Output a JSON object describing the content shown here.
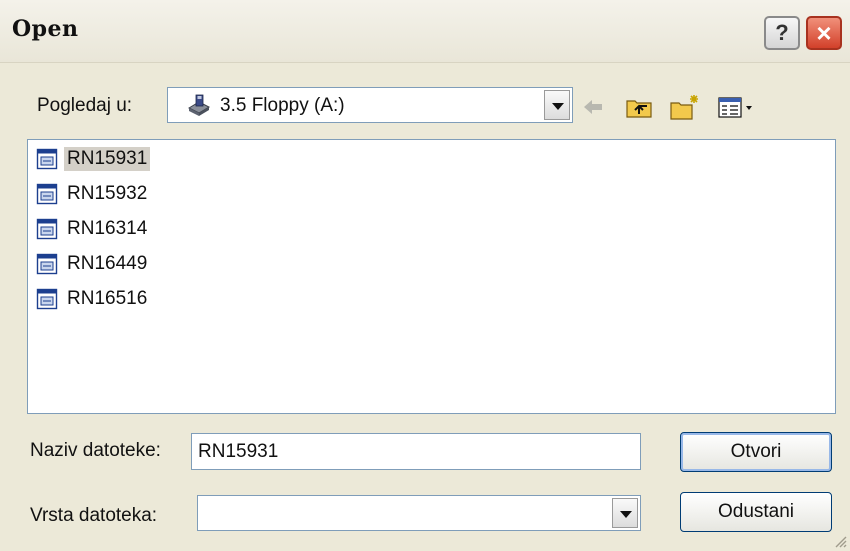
{
  "window": {
    "title": "Open",
    "help_label": "?",
    "close_label": "×"
  },
  "look_in": {
    "label": "Pogledaj u:",
    "value": "3.5 Floppy (A:)"
  },
  "toolbar": {
    "icons": [
      "back-arrow-icon",
      "up-folder-icon",
      "new-folder-icon",
      "view-menu-icon"
    ]
  },
  "files": [
    {
      "name": "RN15931",
      "selected": true
    },
    {
      "name": "RN15932",
      "selected": false
    },
    {
      "name": "RN16314",
      "selected": false
    },
    {
      "name": "RN16449",
      "selected": false
    },
    {
      "name": "RN16516",
      "selected": false
    }
  ],
  "file_name": {
    "label": "Naziv datoteke:",
    "value": "RN15931"
  },
  "file_type": {
    "label": "Vrsta datoteka:",
    "value": ""
  },
  "buttons": {
    "open": "Otvori",
    "cancel": "Odustani"
  },
  "colors": {
    "selection": "#d4d0c8",
    "close": "#d2402a",
    "border": "#7f9db9"
  }
}
